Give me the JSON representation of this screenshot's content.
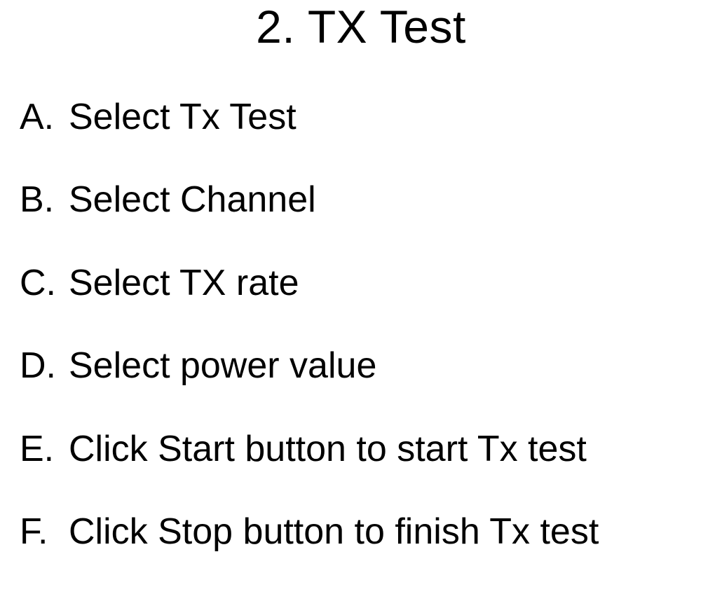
{
  "heading": "2. TX Test",
  "items": [
    {
      "marker": "A.",
      "text": "Select Tx Test"
    },
    {
      "marker": "B.",
      "text": "Select Channel"
    },
    {
      "marker": "C.",
      "text": "Select TX rate"
    },
    {
      "marker": "D.",
      "text": "Select power value"
    },
    {
      "marker": "E.",
      "text": "Click Start button to start Tx test"
    },
    {
      "marker": "F.",
      "text": "Click Stop button to finish Tx test"
    }
  ]
}
